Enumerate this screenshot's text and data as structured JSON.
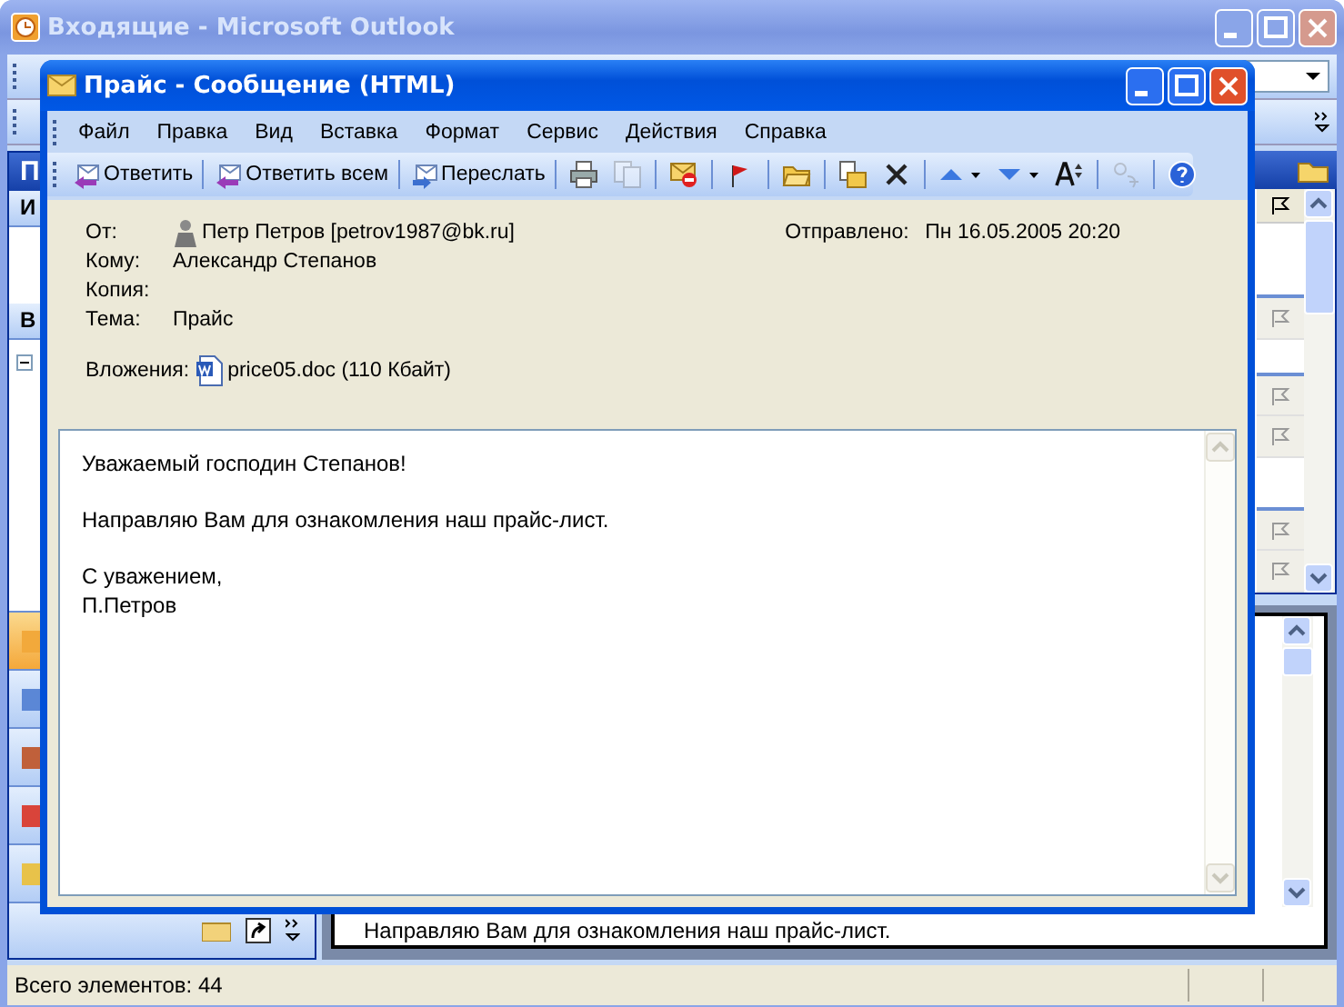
{
  "outlook_window": {
    "title": "Входящие - Microsoft Outlook",
    "pane_header": "П",
    "favorites_header": "И",
    "folders_header": "В",
    "nav_buttons": [
      {
        "selected": true
      },
      {
        "selected": false
      },
      {
        "selected": false
      },
      {
        "selected": false
      },
      {
        "selected": false
      }
    ],
    "reading_pane_text": "Направляю Вам для ознакомления наш прайс-лист.",
    "status_bar": "Всего элементов: 44"
  },
  "message_window": {
    "title": "Прайс - Сообщение (HTML)",
    "menu": [
      "Файл",
      "Правка",
      "Вид",
      "Вставка",
      "Формат",
      "Сервис",
      "Действия",
      "Справка"
    ],
    "toolbar": [
      {
        "kind": "reply",
        "label": "Ответить"
      },
      {
        "kind": "separator"
      },
      {
        "kind": "replyall",
        "label": "Ответить всем"
      },
      {
        "kind": "separator"
      },
      {
        "kind": "forward",
        "label": "Переслать"
      },
      {
        "kind": "separator"
      },
      {
        "kind": "print",
        "disabled": false
      },
      {
        "kind": "copy",
        "disabled": true
      },
      {
        "kind": "separator"
      },
      {
        "kind": "junk",
        "disabled": false
      },
      {
        "kind": "separator"
      },
      {
        "kind": "flag",
        "disabled": false
      },
      {
        "kind": "separator"
      },
      {
        "kind": "folder",
        "disabled": false
      },
      {
        "kind": "separator"
      },
      {
        "kind": "move",
        "disabled": false
      },
      {
        "kind": "delete",
        "disabled": false
      },
      {
        "kind": "separator"
      },
      {
        "kind": "up",
        "disabled": false
      },
      {
        "kind": "down",
        "disabled": false
      },
      {
        "kind": "font",
        "disabled": false
      },
      {
        "kind": "separator"
      },
      {
        "kind": "translate",
        "disabled": true
      },
      {
        "kind": "separator"
      },
      {
        "kind": "help",
        "disabled": false
      }
    ],
    "header": {
      "from_label": "От:",
      "from": "Петр Петров [petrov1987@bk.ru]",
      "sent_label": "Отправлено:",
      "sent": "Пн 16.05.2005 20:20",
      "to_label": "Кому:",
      "to": "Александр Степанов",
      "cc_label": "Копия:",
      "subject_label": "Тема:",
      "subject": "Прайс",
      "attachments_label": "Вложения:",
      "attachment": "price05.doc (110 Кбайт)"
    },
    "body": [
      [
        "Уважаемый господин Степанов!"
      ],
      [
        "Направляю Вам для ознакомления наш прайс-лист."
      ],
      [
        "С уважением,",
        "П.Петров"
      ]
    ]
  }
}
